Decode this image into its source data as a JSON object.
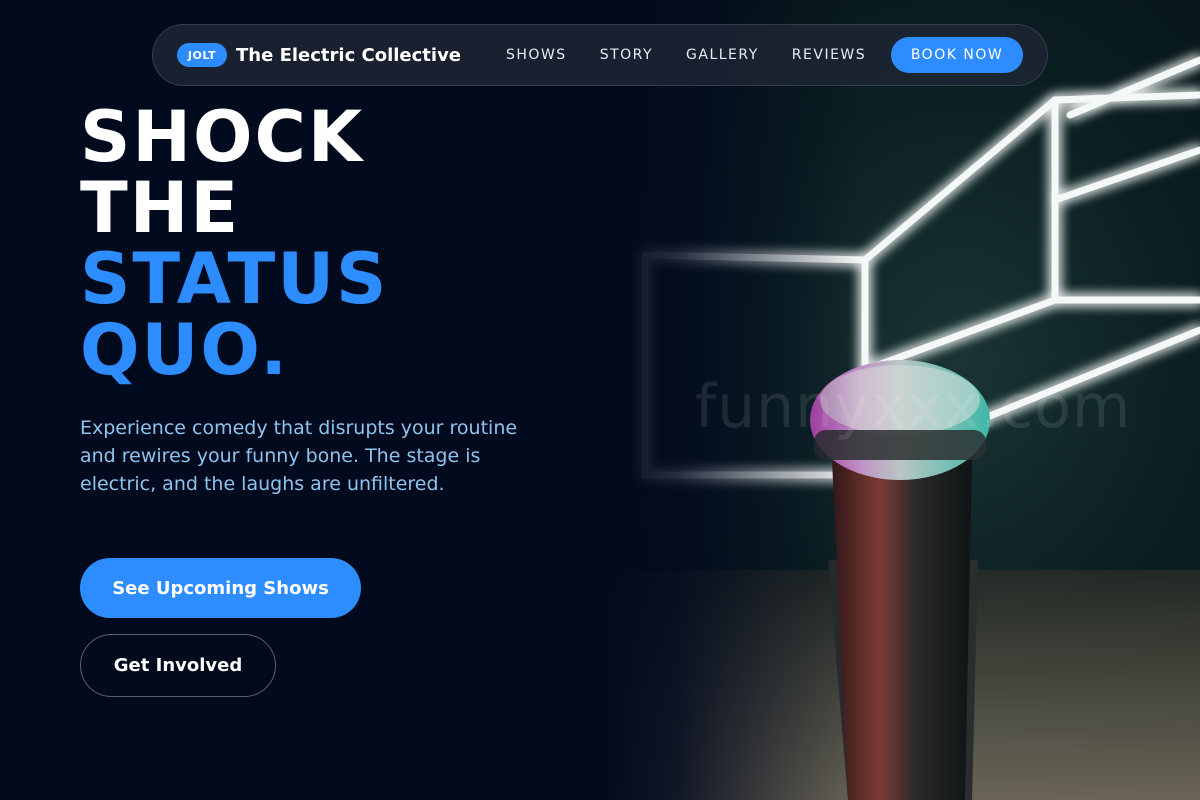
{
  "brand": {
    "badge": "JOLT",
    "name": "The Electric Collective"
  },
  "nav": {
    "links": [
      "SHOWS",
      "STORY",
      "GALLERY",
      "REVIEWS"
    ],
    "cta": "BOOK NOW"
  },
  "hero": {
    "headline_lines": [
      "SHOCK",
      "THE",
      "STATUS",
      "QUO."
    ],
    "lead": "Experience comedy that disrupts your routine and rewires your funny bone. The stage is electric, and the laughs are unfiltered.",
    "primary_cta": "See Upcoming Shows",
    "secondary_cta": "Get Involved",
    "image_watermark": "funnyxxx.com"
  },
  "colors": {
    "background": "#020a1e",
    "accent": "#2d8cff",
    "lead_text": "#8ec3ef",
    "nav_bg": "#1e2634"
  }
}
